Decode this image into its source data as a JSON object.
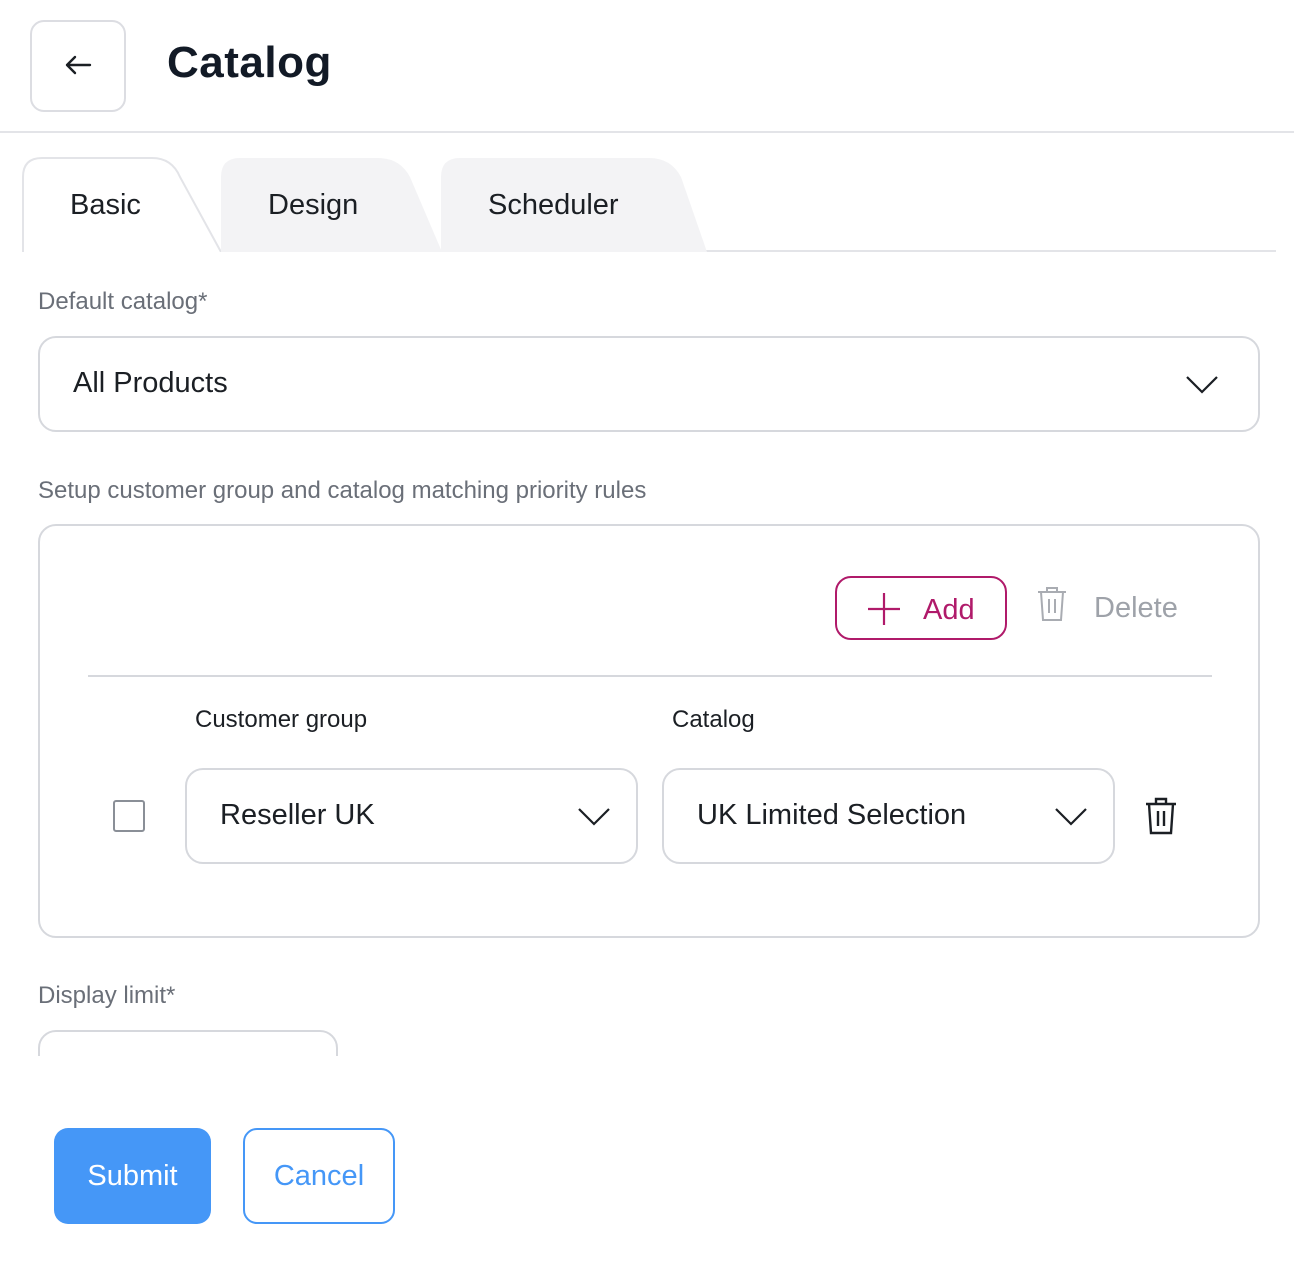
{
  "header": {
    "title": "Catalog",
    "back_icon": "arrow-left-icon"
  },
  "tabs": [
    {
      "label": "Basic",
      "active": true
    },
    {
      "label": "Design",
      "active": false
    },
    {
      "label": "Scheduler",
      "active": false
    }
  ],
  "form": {
    "default_catalog": {
      "label": "Default catalog*",
      "value": "All Products"
    },
    "rules": {
      "label": "Setup customer group and catalog matching priority rules",
      "add_label": "Add",
      "delete_label": "Delete",
      "columns": {
        "customer_group": "Customer group",
        "catalog": "Catalog"
      },
      "rows": [
        {
          "checked": false,
          "customer_group": "Reseller UK",
          "catalog": "UK Limited Selection"
        }
      ]
    },
    "display_limit": {
      "label": "Display limit*"
    }
  },
  "actions": {
    "submit_label": "Submit",
    "cancel_label": "Cancel"
  },
  "colors": {
    "accent_magenta": "#b01a6a",
    "primary_blue": "#4597f7",
    "border_gray": "#d6d8dd",
    "tab_inactive_bg": "#f3f3f5"
  }
}
